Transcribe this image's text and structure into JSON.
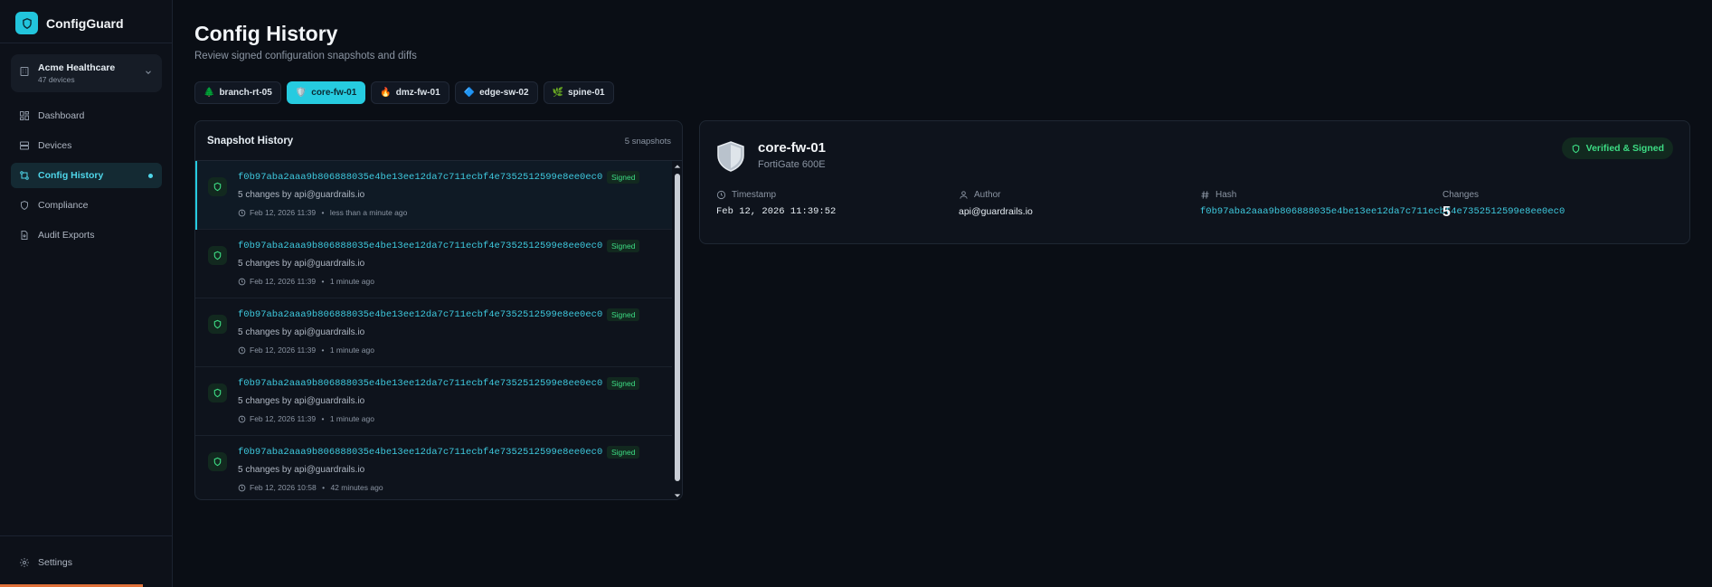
{
  "brand": {
    "name": "ConfigGuard"
  },
  "org": {
    "name": "Acme Healthcare",
    "devices": "47 devices"
  },
  "nav": [
    {
      "label": "Dashboard",
      "icon": "grid-icon"
    },
    {
      "label": "Devices",
      "icon": "server-icon"
    },
    {
      "label": "Config History",
      "icon": "git-compare-icon"
    },
    {
      "label": "Compliance",
      "icon": "shield-icon"
    },
    {
      "label": "Audit Exports",
      "icon": "file-export-icon"
    }
  ],
  "settings": {
    "label": "Settings"
  },
  "header": {
    "title": "Config History",
    "subtitle": "Review signed configuration snapshots and diffs"
  },
  "tabs": [
    {
      "emoji": "🌲",
      "label": "branch-rt-05"
    },
    {
      "emoji": "🛡️",
      "label": "core-fw-01"
    },
    {
      "emoji": "🔥",
      "label": "dmz-fw-01"
    },
    {
      "emoji": "🔷",
      "label": "edge-sw-02"
    },
    {
      "emoji": "🌿",
      "label": "spine-01"
    }
  ],
  "snapshots": {
    "title": "Snapshot History",
    "count": "5 snapshots",
    "items": [
      {
        "hash": "f0b97aba2aaa9b806888035e4be13ee12da7c711ecbf4e7352512599e8ee0ec0",
        "signed": "Signed",
        "changes": "5 changes by api@guardrails.io",
        "date": "Feb 12, 2026 11:39",
        "ago": "less than a minute ago"
      },
      {
        "hash": "f0b97aba2aaa9b806888035e4be13ee12da7c711ecbf4e7352512599e8ee0ec0",
        "signed": "Signed",
        "changes": "5 changes by api@guardrails.io",
        "date": "Feb 12, 2026 11:39",
        "ago": "1 minute ago"
      },
      {
        "hash": "f0b97aba2aaa9b806888035e4be13ee12da7c711ecbf4e7352512599e8ee0ec0",
        "signed": "Signed",
        "changes": "5 changes by api@guardrails.io",
        "date": "Feb 12, 2026 11:39",
        "ago": "1 minute ago"
      },
      {
        "hash": "f0b97aba2aaa9b806888035e4be13ee12da7c711ecbf4e7352512599e8ee0ec0",
        "signed": "Signed",
        "changes": "5 changes by api@guardrails.io",
        "date": "Feb 12, 2026 11:39",
        "ago": "1 minute ago"
      },
      {
        "hash": "f0b97aba2aaa9b806888035e4be13ee12da7c711ecbf4e7352512599e8ee0ec0",
        "signed": "Signed",
        "changes": "5 changes by api@guardrails.io",
        "date": "Feb 12, 2026 10:58",
        "ago": "42 minutes ago"
      }
    ]
  },
  "detail": {
    "name": "core-fw-01",
    "model": "FortiGate 600E",
    "status": "Verified & Signed",
    "timestamp_label": "Timestamp",
    "timestamp": "Feb 12, 2026 11:39:52",
    "author_label": "Author",
    "author": "api@guardrails.io",
    "hash_label": "Hash",
    "hash": "f0b97aba2aaa9b806888035e4be13ee12da7c711ecbf4e7352512599e8ee0ec0",
    "changes_label": "Changes",
    "changes": "5"
  },
  "colors": {
    "accent": "#26cbe0",
    "success": "#3ddc84",
    "background": "#0a0e15",
    "warning_line": "#e0713a"
  }
}
